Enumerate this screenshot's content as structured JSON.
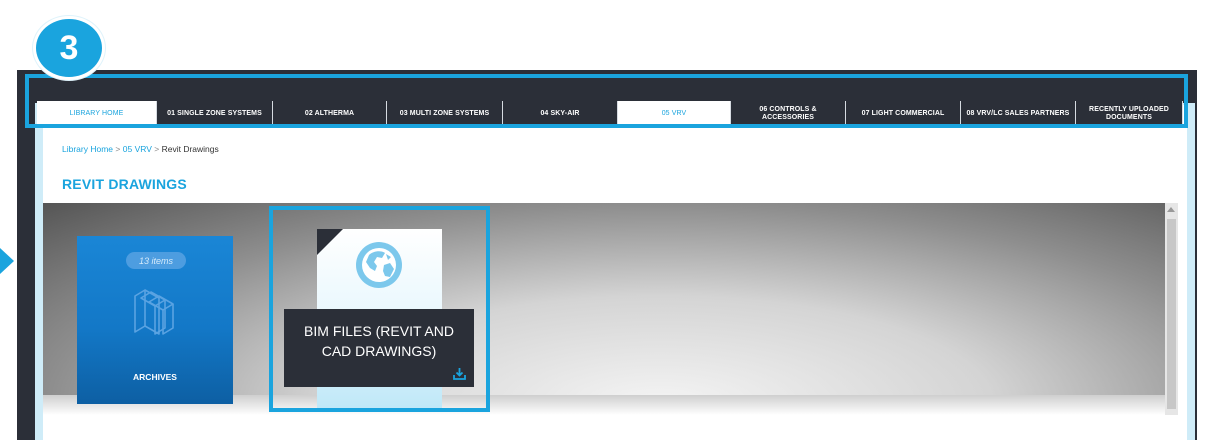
{
  "step": "3",
  "nav": {
    "items": [
      {
        "label": "LIBRARY HOME",
        "style": "light"
      },
      {
        "label": "01 SINGLE ZONE SYSTEMS",
        "style": "dark"
      },
      {
        "label": "02 ALTHERMA",
        "style": "dark"
      },
      {
        "label": "03 MULTI ZONE SYSTEMS",
        "style": "dark"
      },
      {
        "label": "04 SKY-AIR",
        "style": "dark"
      },
      {
        "label": "05 VRV",
        "style": "light"
      },
      {
        "label": "06 CONTROLS & ACCESSORIES",
        "style": "dark"
      },
      {
        "label": "07 LIGHT COMMERCIAL",
        "style": "dark"
      },
      {
        "label": "08 VRV/LC SALES PARTNERS",
        "style": "dark"
      },
      {
        "label": "RECENTLY UPLOADED DOCUMENTS",
        "style": "dark"
      }
    ]
  },
  "breadcrumb": {
    "home": "Library Home",
    "separator": ">",
    "section": "05 VRV",
    "current": "Revit Drawings"
  },
  "page_title": "REVIT DRAWINGS",
  "folder": {
    "count": "13 items",
    "label": "ARCHIVES",
    "icon": "books-icon"
  },
  "document": {
    "title": "BIM FILES (REVIT AND CAD DRAWINGS)",
    "icon": "globe-icon",
    "action_icon": "download-icon"
  },
  "colors": {
    "accent": "#1aa4de",
    "dark": "#2b2f38",
    "folder": "#1378c7"
  }
}
